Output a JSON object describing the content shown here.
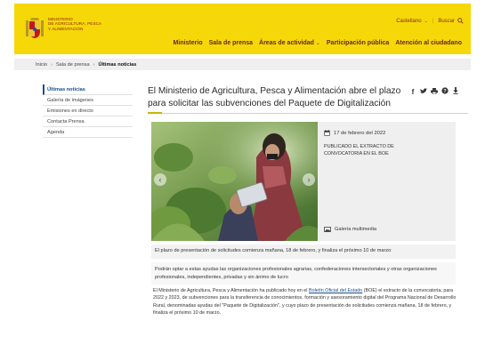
{
  "header": {
    "ministry_lines": [
      "Ministerio",
      "de Agricultura, Pesca",
      "y Alimentación"
    ],
    "lang_label": "Castellano",
    "search_label": "Buscar",
    "nav": [
      {
        "label": "Ministerio",
        "has_chevron": false
      },
      {
        "label": "Sala de prensa",
        "has_chevron": false
      },
      {
        "label": "Áreas de actividad",
        "has_chevron": true
      },
      {
        "label": "Participación pública",
        "has_chevron": false
      },
      {
        "label": "Atención al ciudadano",
        "has_chevron": false
      }
    ],
    "colors": {
      "band": "#f6d808",
      "nav_text": "#6b2410"
    }
  },
  "breadcrumb": {
    "items": [
      "Inicio",
      "Sala de prensa",
      "Últimas noticias"
    ]
  },
  "sidebar": {
    "items": [
      {
        "label": "Últimas noticias",
        "active": true
      },
      {
        "label": "Galería de imágenes",
        "active": false
      },
      {
        "label": "Emisiones en directo",
        "active": false
      },
      {
        "label": "Contacta Prensa",
        "active": false
      },
      {
        "label": "Agenda",
        "active": false
      }
    ]
  },
  "article": {
    "title": "El Ministerio de Agricultura, Pesca y Alimentación abre el plazo para solicitar las subvenciones del Paquete de Digitalización",
    "share_icons": [
      "facebook-icon",
      "twitter-icon",
      "print-icon",
      "help-icon",
      "download-icon"
    ],
    "date": "17 de febrero del 2022",
    "published": "PUBLICADO EL EXTRACTO DE CONVOCATORIA EN EL BOE",
    "gallery_label": "Galería multimedia",
    "caption": "El plazo de presentación de solicitudes comienza mañana, 18 de febrero, y finaliza el próximo 10 de marzo",
    "lead": "Podrán optar a estas ayudas las organizaciones profesionales agrarias, confederaciones intersectoriales y otras organizaciones profesionales, independientes, privadas y sin ánimo de lucro",
    "body_before_link": "El Ministerio de Agricultura, Pesca y Alimentación ha publicado hoy en el ",
    "body_link": "Boletín Oficial del Estado",
    "body_after_link": " (BOE) el extracto de la convocatoria, para 2022 y 2023, de subvenciones para la transferencia de conocimientos, formación y asesoramiento digital del Programa Nacional de Desarrollo Rural, denominadas ayudas del \"Paquete de Digitalización\", y cuyo plazo de presentación de solicitudes comienza mañana, 18 de febrero, y finaliza el próximo 10 de marzo."
  }
}
